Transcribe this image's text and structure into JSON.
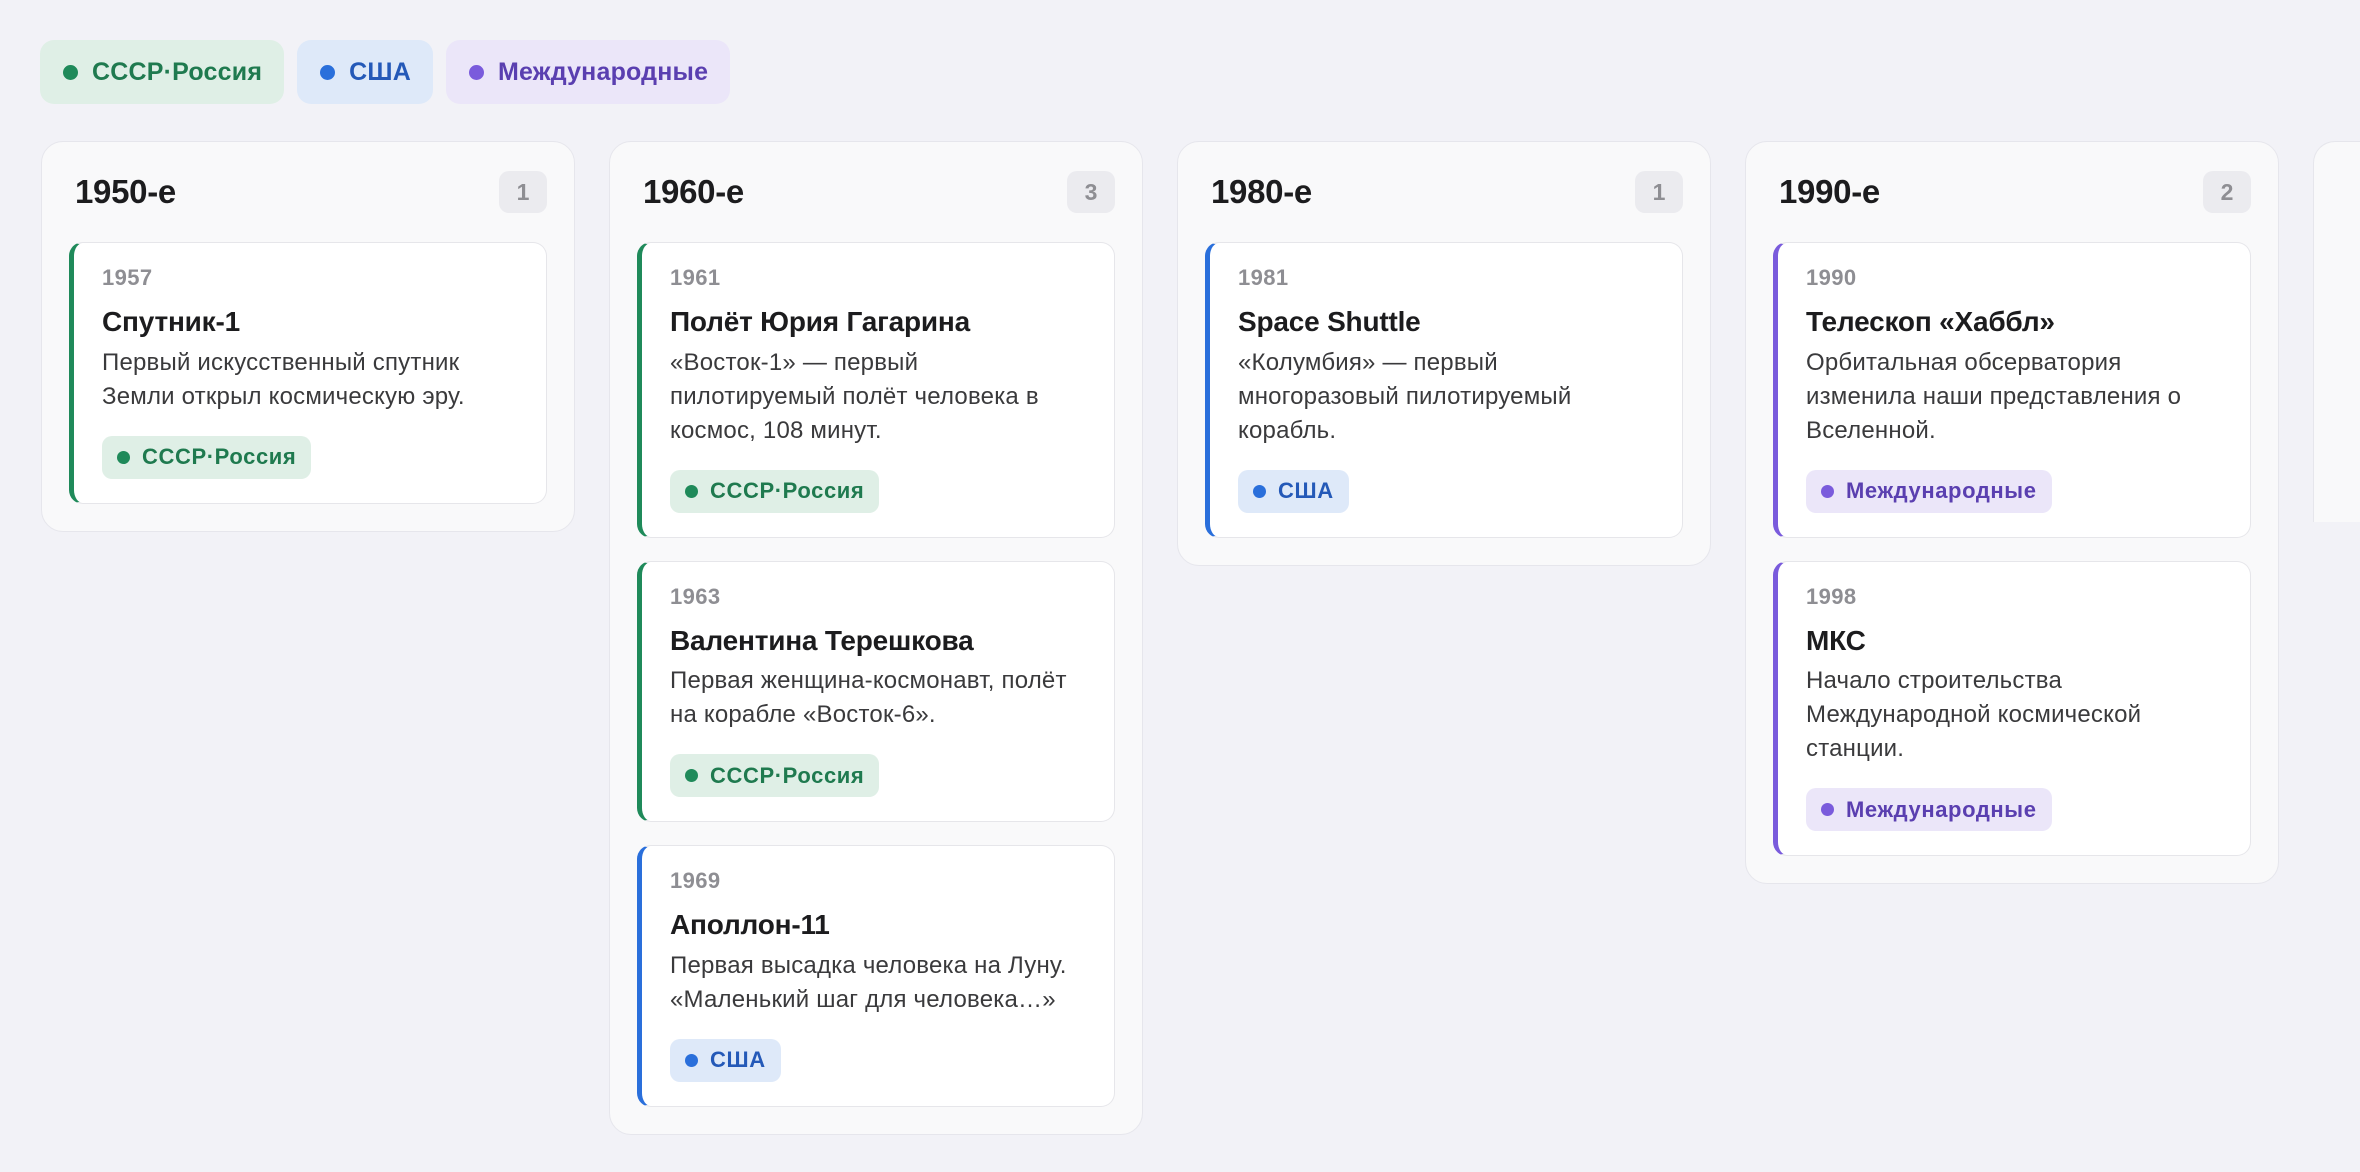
{
  "legend": [
    {
      "label": "СССР·Россия",
      "category": "ussr",
      "color": "#1f8a5a"
    },
    {
      "label": "США",
      "category": "usa",
      "color": "#2a6fdb"
    },
    {
      "label": "Международные",
      "category": "intl",
      "color": "#7a5bdc"
    }
  ],
  "columns": [
    {
      "title": "1950-е",
      "count": "1",
      "cards": [
        {
          "year": "1957",
          "title": "Спутник-1",
          "desc": "Первый искусственный спутник Земли открыл космическую эру.",
          "tag": "СССР·Россия",
          "category": "ussr"
        }
      ]
    },
    {
      "title": "1960-е",
      "count": "3",
      "cards": [
        {
          "year": "1961",
          "title": "Полёт Юрия Гагарина",
          "desc": "«Восток-1» — первый пилотируемый полёт человека в космос, 108 минут.",
          "tag": "СССР·Россия",
          "category": "ussr"
        },
        {
          "year": "1963",
          "title": "Валентина Терешкова",
          "desc": "Первая женщина-космонавт, полёт на корабле «Восток-6».",
          "tag": "СССР·Россия",
          "category": "ussr"
        },
        {
          "year": "1969",
          "title": "Аполлон-11",
          "desc": "Первая высадка человека на Луну. «Маленький шаг для человека…»",
          "tag": "США",
          "category": "usa"
        }
      ]
    },
    {
      "title": "1980-е",
      "count": "1",
      "cards": [
        {
          "year": "1981",
          "title": "Space Shuttle",
          "desc": "«Колумбия» — первый многоразовый пилотируемый корабль.",
          "tag": "США",
          "category": "usa"
        }
      ]
    },
    {
      "title": "1990-е",
      "count": "2",
      "cards": [
        {
          "year": "1990",
          "title": "Телескоп «Хаббл»",
          "desc": "Орбитальная обсерватория изменила наши представления о Вселенной.",
          "tag": "Международные",
          "category": "intl"
        },
        {
          "year": "1998",
          "title": "МКС",
          "desc": "Начало строительства Международной космической станции.",
          "tag": "Международные",
          "category": "intl"
        }
      ]
    }
  ]
}
